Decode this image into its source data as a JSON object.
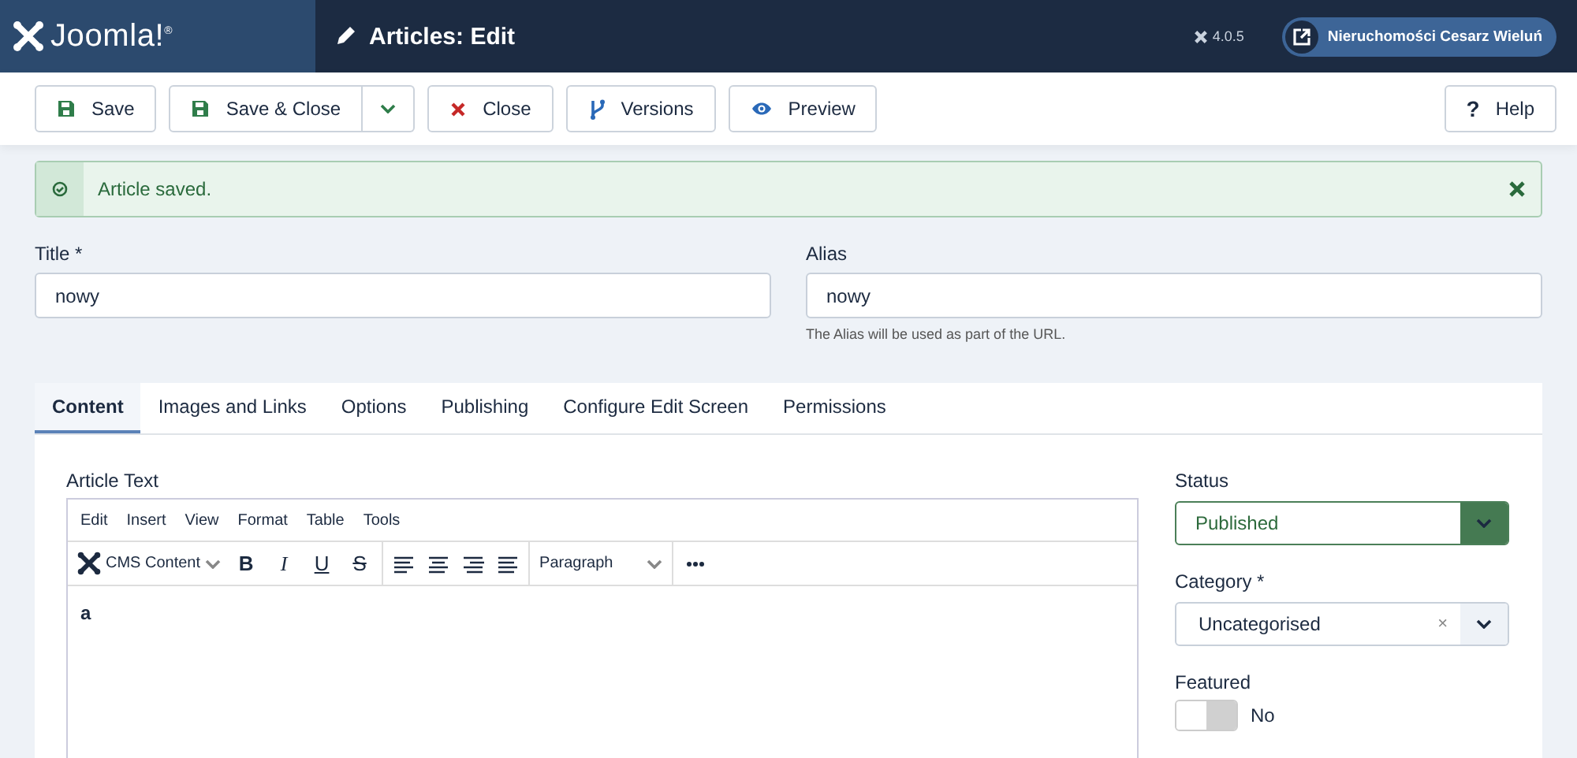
{
  "header": {
    "logo": "Joomla!$^{®}$",
    "title": "Articles: Edit",
    "version": "4.0.5",
    "site_link": "Nieruchomości Cesarz Wieluń"
  },
  "toolbar": {
    "buttons": [
      {
        "kind": "save",
        "label": "Save"
      },
      {
        "kind": "save-close",
        "label": "Save & Close"
      },
      {
        "kind": "close",
        "label": "Close"
      },
      {
        "kind": "versions",
        "label": "Versions"
      },
      {
        "kind": "preview",
        "label": "Preview"
      }
    ],
    "help": {
      "icon": "?",
      "label": "Help"
    }
  },
  "alert": {
    "message": "Article saved."
  },
  "fields": [
    {
      "label": "Title *",
      "value": "nowy"
    },
    {
      "label": "Alias",
      "value": "nowy",
      "help": "The Alias will be used as part of the URL."
    }
  ],
  "tabs": [
    {
      "label": "Content",
      "selected": true
    },
    {
      "label": "Images and Links",
      "selected": false
    },
    {
      "label": "Options",
      "selected": false
    },
    {
      "label": "Publishing",
      "selected": false
    },
    {
      "label": "Configure Edit Screen",
      "selected": false
    },
    {
      "label": "Permissions",
      "selected": false
    }
  ],
  "editor": {
    "label": "Article Text",
    "menu": [
      "Edit",
      "Insert",
      "View",
      "Format",
      "Table",
      "Tools"
    ],
    "plugin": "CMS Content",
    "styles": [
      "B",
      "I",
      "U",
      "S"
    ],
    "block_format": "Paragraph",
    "content": "a"
  },
  "sidebar": {
    "status": {
      "label": "Status",
      "value": "Published"
    },
    "category": {
      "label": "Category *",
      "value": "Uncategorised",
      "clear": "×"
    },
    "featured": {
      "label": "Featured",
      "on": false,
      "value": "No"
    }
  }
}
